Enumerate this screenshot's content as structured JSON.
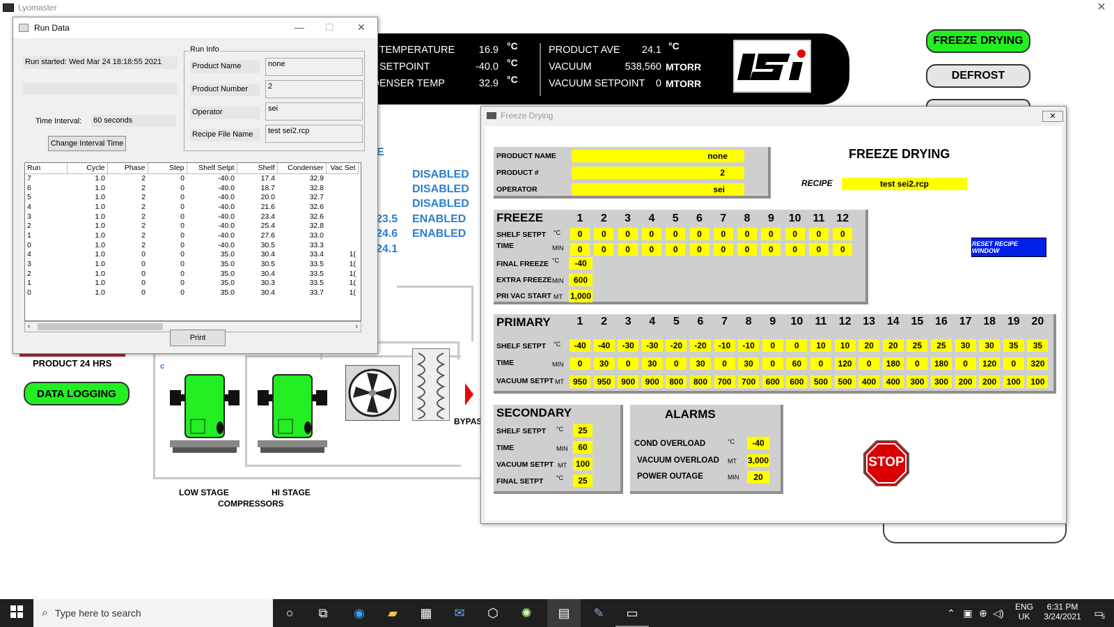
{
  "app": {
    "title": "Lyomaster",
    "close": "✕"
  },
  "header": {
    "shelf_temp_label": "LF TEMPERATURE",
    "shelf_temp_value": "16.9",
    "shelf_setpoint_label": "LF SETPOINT",
    "shelf_setpoint_value": "-40.0",
    "condenser_label": "NDENSER TEMP",
    "condenser_value": "32.9",
    "deg_c": "°C",
    "product_ave_label": "PRODUCT AVE",
    "product_ave_value": "24.1",
    "vacuum_label": "VACUUM",
    "vacuum_value": "538,560",
    "vacuum_setpoint_label": "VACUUM SETPOINT",
    "vacuum_setpoint_value": "0",
    "mtorr": "MTORR",
    "logo_text": "ISi"
  },
  "mode_buttons": {
    "freeze_drying": "FREEZE DRYING",
    "defrost": "DEFROST"
  },
  "status": {
    "e_letter": "E",
    "items": [
      "DISABLED",
      "DISABLED",
      "DISABLED",
      "ENABLED",
      "ENABLED"
    ],
    "readings": [
      "23.5",
      "24.6",
      "24.1"
    ]
  },
  "bottom_left": {
    "product_hrs": "PRODUCT 24 HRS",
    "data_logging": "DATA LOGGING",
    "c": "c"
  },
  "compressors": {
    "low": "LOW STAGE",
    "hi": "HI STAGE",
    "label": "COMPRESSORS",
    "bypass": "BYPAS"
  },
  "run_data": {
    "title": "Run Data",
    "run_started": "Run started: Wed Mar 24 18:18:55 2021",
    "time_interval_label": "Time Interval:",
    "time_interval_value": "60 seconds",
    "change_interval_btn": "Change Interval Time",
    "run_info_label": "Run Info",
    "product_name_label": "Product Name",
    "product_name_value": "none",
    "product_number_label": "Product Number",
    "product_number_value": "2",
    "operator_label": "Operator",
    "operator_value": "sei",
    "recipe_label": "Recipe File Name",
    "recipe_value": "test sei2.rcp",
    "columns": [
      "Run",
      "Cycle",
      "Phase",
      "Step",
      "Shelf Setpt",
      "Shelf",
      "Condenser",
      "Vac Set"
    ],
    "rows": [
      [
        "7",
        "1.0",
        "2",
        "0",
        "-40.0",
        "17.4",
        "32.9",
        ""
      ],
      [
        "6",
        "1.0",
        "2",
        "0",
        "-40.0",
        "18.7",
        "32.8",
        ""
      ],
      [
        "5",
        "1.0",
        "2",
        "0",
        "-40.0",
        "20.0",
        "32.7",
        ""
      ],
      [
        "4",
        "1.0",
        "2",
        "0",
        "-40.0",
        "21.6",
        "32.6",
        ""
      ],
      [
        "3",
        "1.0",
        "2",
        "0",
        "-40.0",
        "23.4",
        "32.6",
        ""
      ],
      [
        "2",
        "1.0",
        "2",
        "0",
        "-40.0",
        "25.4",
        "32.8",
        ""
      ],
      [
        "1",
        "1.0",
        "2",
        "0",
        "-40.0",
        "27.6",
        "33.0",
        ""
      ],
      [
        "0",
        "1.0",
        "2",
        "0",
        "-40.0",
        "30.5",
        "33.3",
        ""
      ],
      [
        "4",
        "1.0",
        "0",
        "0",
        "35.0",
        "30.4",
        "33.4",
        "1("
      ],
      [
        "3",
        "1.0",
        "0",
        "0",
        "35.0",
        "30.5",
        "33.5",
        "1("
      ],
      [
        "2",
        "1.0",
        "0",
        "0",
        "35.0",
        "30.4",
        "33.5",
        "1("
      ],
      [
        "1",
        "1.0",
        "0",
        "0",
        "35.0",
        "30.3",
        "33.5",
        "1("
      ],
      [
        "0",
        "1.0",
        "0",
        "0",
        "35.0",
        "30.4",
        "33.7",
        "1("
      ]
    ],
    "print_btn": "Print"
  },
  "freeze_window": {
    "title": "Freeze Drying",
    "close": "✕",
    "heading": "FREEZE DRYING",
    "product_name_label": "PRODUCT NAME",
    "product_name_value": "none",
    "product_num_label": "PRODUCT #",
    "product_num_value": "2",
    "operator_label": "OPERATOR",
    "operator_value": "sei",
    "recipe_label": "RECIPE",
    "recipe_value": "test sei2.rcp",
    "reset_btn": "RESET RECIPE WINDOW",
    "freeze": {
      "title": "FREEZE",
      "steps": [
        "1",
        "2",
        "3",
        "4",
        "5",
        "6",
        "7",
        "8",
        "9",
        "10",
        "11",
        "12"
      ],
      "shelf_label": "SHELF SETPT",
      "shelf_unit": "°C",
      "shelf_values": [
        "0",
        "0",
        "0",
        "0",
        "0",
        "0",
        "0",
        "0",
        "0",
        "0",
        "0",
        "0"
      ],
      "time_label": "TIME",
      "time_unit": "MIN",
      "time_values": [
        "0",
        "0",
        "0",
        "0",
        "0",
        "0",
        "0",
        "0",
        "0",
        "0",
        "0",
        "0"
      ],
      "final_freeze_label": "FINAL FREEZE",
      "final_freeze_unit": "°C",
      "final_freeze_value": "-40",
      "extra_freeze_label": "EXTRA FREEZE",
      "extra_freeze_unit": "MIN",
      "extra_freeze_value": "600",
      "pri_vac_label": "PRI VAC START",
      "pri_vac_unit": "MT",
      "pri_vac_value": "1,000"
    },
    "primary": {
      "title": "PRIMARY",
      "steps": [
        "1",
        "2",
        "3",
        "4",
        "5",
        "6",
        "7",
        "8",
        "9",
        "10",
        "11",
        "12",
        "13",
        "14",
        "15",
        "16",
        "17",
        "18",
        "19",
        "20"
      ],
      "shelf_label": "SHELF SETPT",
      "shelf_unit": "°C",
      "shelf_values": [
        "-40",
        "-40",
        "-30",
        "-30",
        "-20",
        "-20",
        "-10",
        "-10",
        "0",
        "0",
        "10",
        "10",
        "20",
        "20",
        "25",
        "25",
        "30",
        "30",
        "35",
        "35"
      ],
      "time_label": "TIME",
      "time_unit": "MIN",
      "time_values": [
        "0",
        "30",
        "0",
        "30",
        "0",
        "30",
        "0",
        "30",
        "0",
        "60",
        "0",
        "120",
        "0",
        "180",
        "0",
        "180",
        "0",
        "120",
        "0",
        "320"
      ],
      "vac_label": "VACUUM SETPT",
      "vac_unit": "MT",
      "vac_values": [
        "950",
        "950",
        "900",
        "900",
        "800",
        "800",
        "700",
        "700",
        "600",
        "600",
        "500",
        "500",
        "400",
        "400",
        "300",
        "300",
        "200",
        "200",
        "100",
        "100"
      ]
    },
    "secondary": {
      "title": "SECONDARY",
      "shelf_label": "SHELF SETPT",
      "shelf_unit": "°C",
      "shelf_value": "25",
      "time_label": "TIME",
      "time_unit": "MIN",
      "time_value": "60",
      "vac_label": "VACUUM SETPT",
      "vac_unit": "MT",
      "vac_value": "100",
      "final_label": "FINAL  SETPT",
      "final_unit": "°C",
      "final_value": "25"
    },
    "alarms": {
      "title": "ALARMS",
      "cond_label": "COND OVERLOAD",
      "cond_unit": "°C",
      "cond_value": "-40",
      "vac_label": "VACUUM OVERLOAD",
      "vac_unit": "MT",
      "vac_value": "3,000",
      "power_label": "POWER OUTAGE",
      "power_unit": "MIN",
      "power_value": "20"
    },
    "stop": "STOP"
  },
  "taskbar": {
    "search_placeholder": "Type here to search",
    "lang": "ENG",
    "region": "UK",
    "time": "6:31 PM",
    "date": "3/24/2021",
    "notif": "5"
  }
}
